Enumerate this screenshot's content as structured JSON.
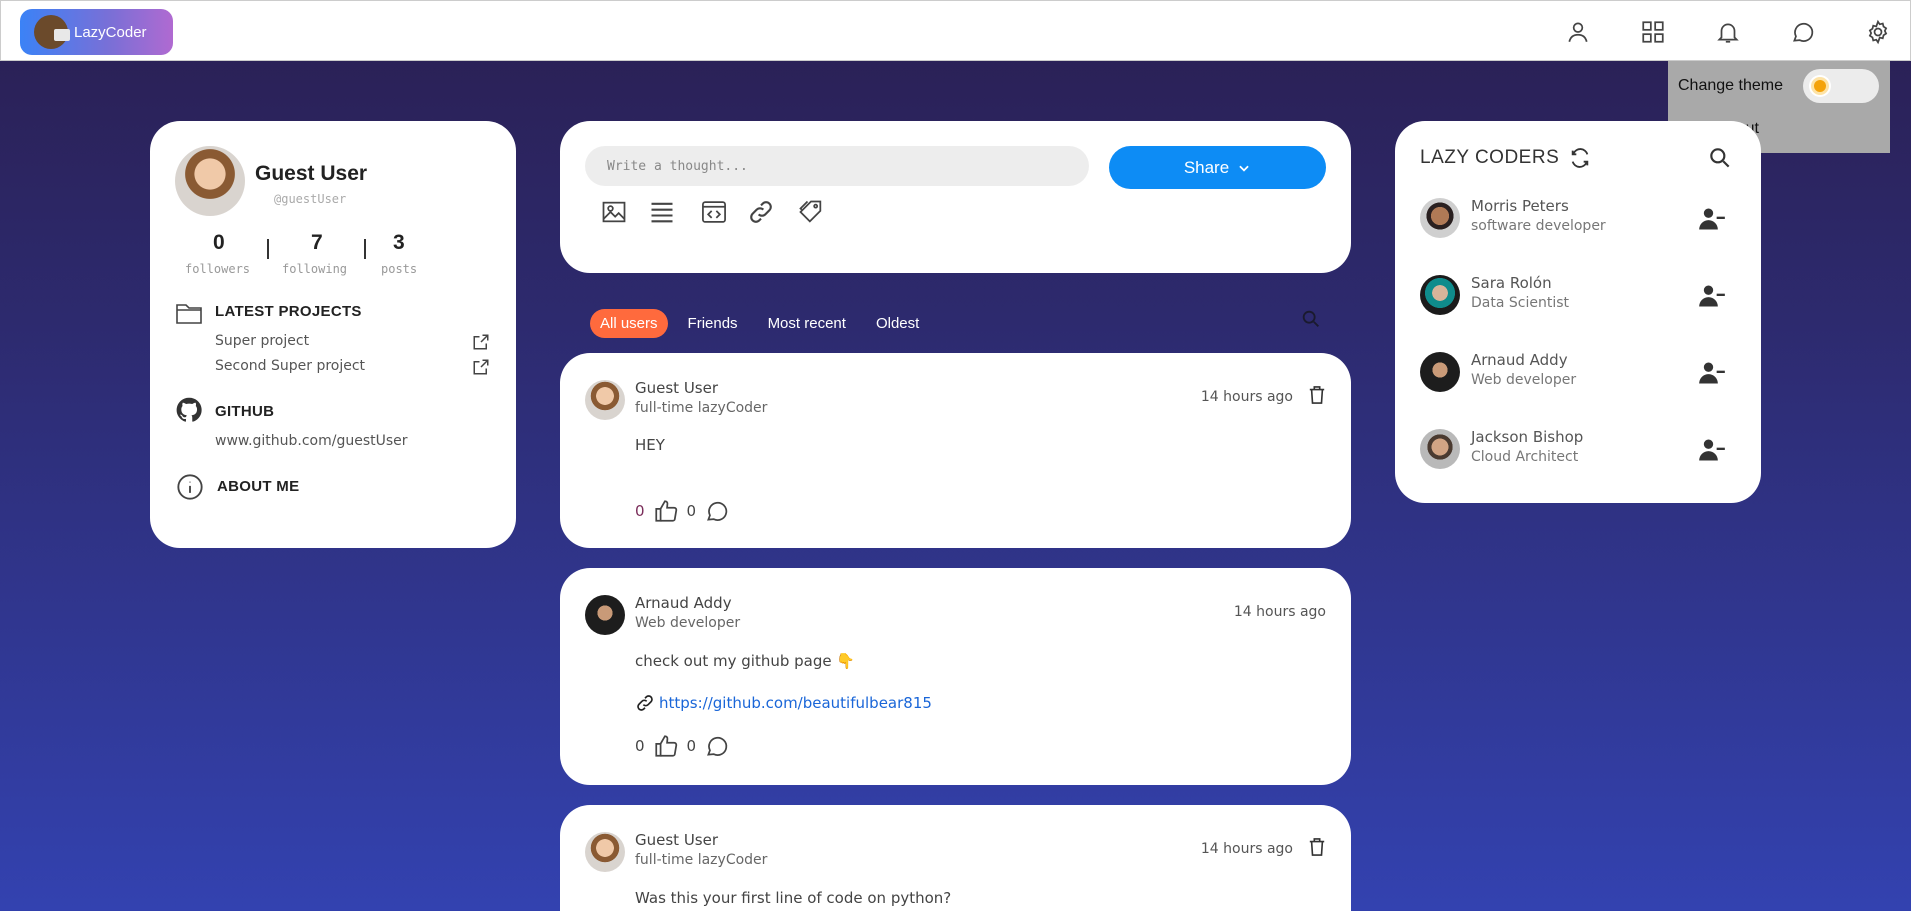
{
  "app": {
    "logo_text": "LazyCoder",
    "nav_icons": [
      "user-icon",
      "grid-icon",
      "bell-icon",
      "chat-icon",
      "gear-icon"
    ]
  },
  "settings_menu": {
    "change_theme_label": "Change theme",
    "logout_label": "Logout",
    "theme_toggle_on": false
  },
  "profile": {
    "name": "Guest User",
    "handle": "@guestUser",
    "stats": [
      {
        "value": "0",
        "label": "followers"
      },
      {
        "value": "7",
        "label": "following"
      },
      {
        "value": "3",
        "label": "posts"
      }
    ],
    "latest_projects_heading": "LATEST PROJECTS",
    "projects": [
      "Super project",
      "Second Super project"
    ],
    "github_heading": "GITHUB",
    "github_url": "www.github.com/guestUser",
    "about_heading": "ABOUT ME"
  },
  "composer": {
    "placeholder": "Write a thought...",
    "share_label": "Share",
    "tool_icons": [
      "image-icon",
      "list-icon",
      "code-icon",
      "link-icon",
      "tag-icon"
    ]
  },
  "filters": {
    "tabs": [
      "All users",
      "Friends",
      "Most recent",
      "Oldest"
    ],
    "active": "All users"
  },
  "posts": [
    {
      "author": "Guest User",
      "title": "full-time lazyCoder",
      "time": "14 hours ago",
      "body": "HEY",
      "link": "",
      "likes": "0",
      "comments": "0",
      "deletable": true
    },
    {
      "author": "Arnaud Addy",
      "title": "Web developer",
      "time": "14 hours ago",
      "body": "check out my github page 👇",
      "link": "https://github.com/beautifulbear815",
      "likes": "0",
      "comments": "0",
      "deletable": false
    },
    {
      "author": "Guest User",
      "title": "full-time lazyCoder",
      "time": "14 hours ago",
      "body": "Was this your first line of code on python?",
      "link": "",
      "likes": "",
      "comments": "",
      "deletable": true
    }
  ],
  "coders": {
    "title": "LAZY CODERS",
    "list": [
      {
        "name": "Morris Peters",
        "role": "software developer"
      },
      {
        "name": "Sara Rolón",
        "role": "Data Scientist"
      },
      {
        "name": "Arnaud Addy",
        "role": "Web developer"
      },
      {
        "name": "Jackson Bishop",
        "role": "Cloud Architect"
      }
    ]
  },
  "colors": {
    "accent_blue": "#0d8cf5",
    "active_tab": "#ff6a3d",
    "link": "#1a66d8"
  }
}
